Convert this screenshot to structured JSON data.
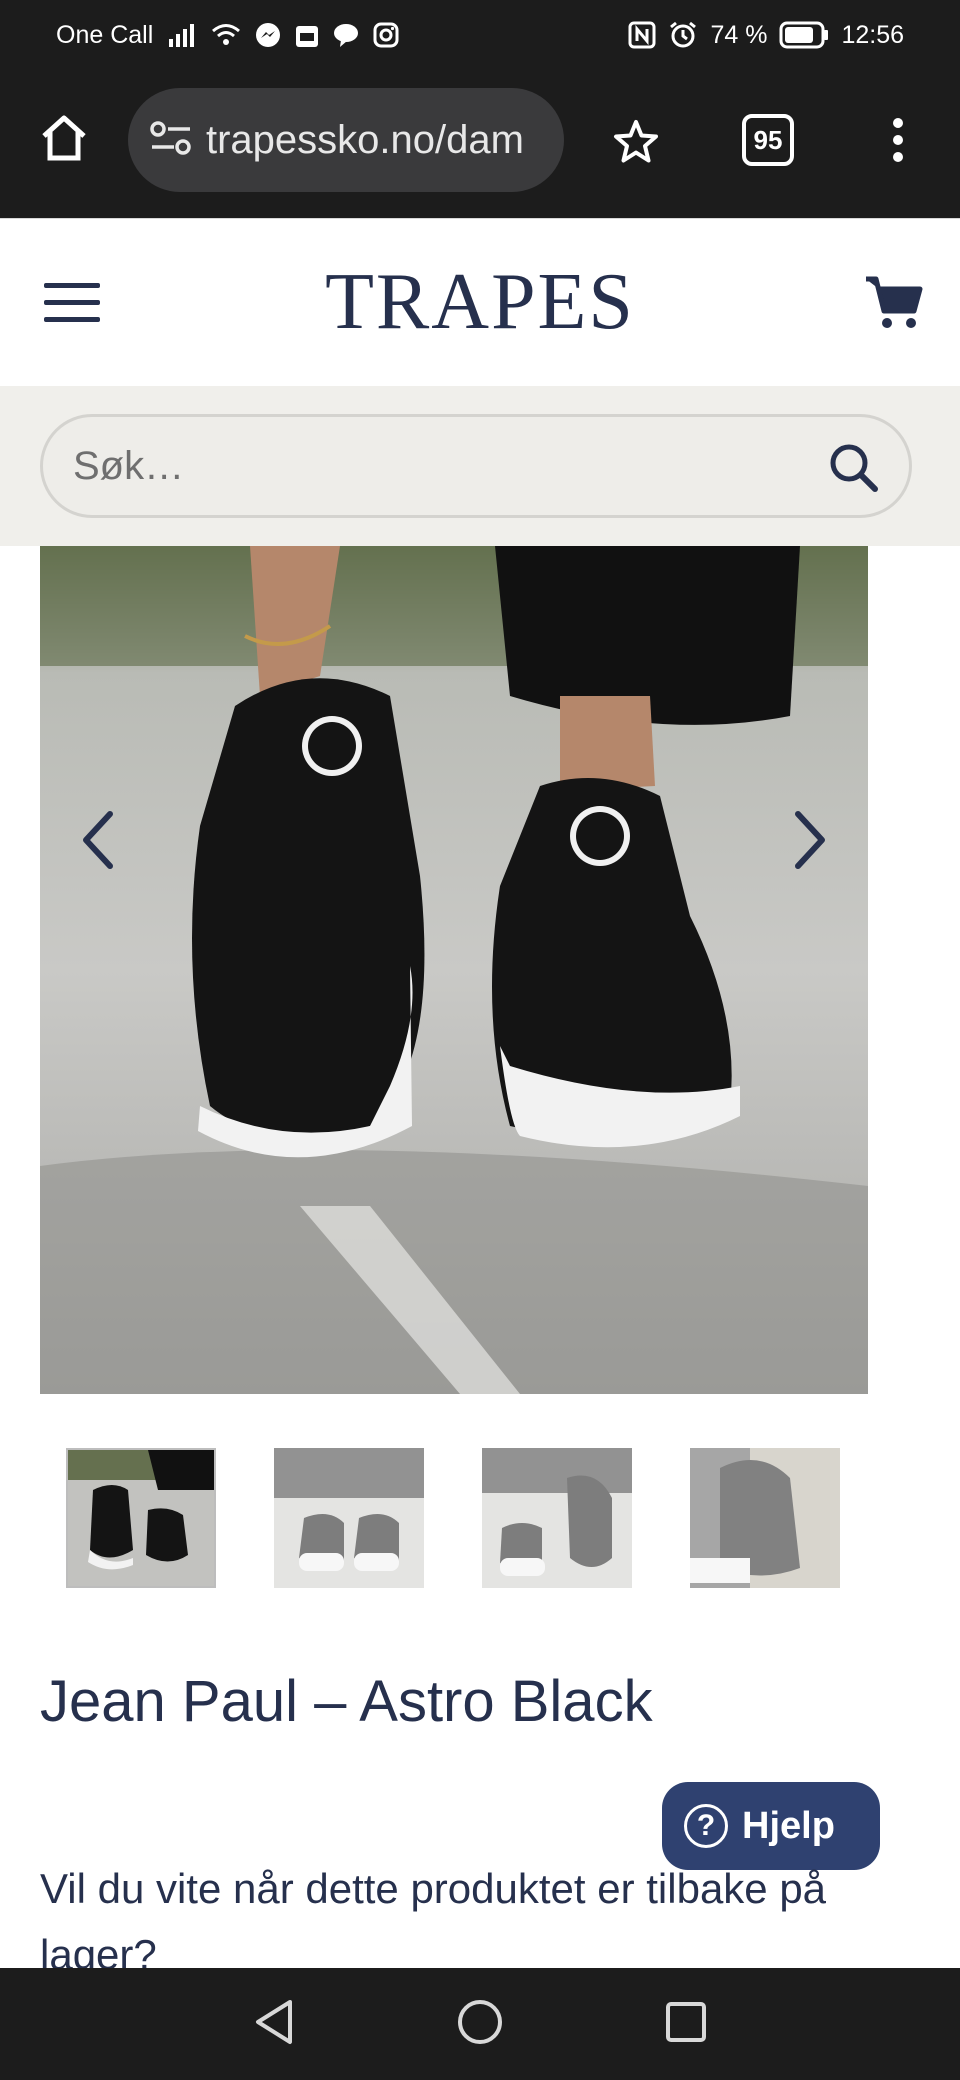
{
  "status_bar": {
    "carrier": "One Call",
    "battery": "74 %",
    "time": "12:56"
  },
  "browser": {
    "url": "trapessko.no/dam",
    "tab_count": "95"
  },
  "site": {
    "logo": "TRAPES"
  },
  "search": {
    "placeholder": "Søk…"
  },
  "product": {
    "title": "Jean Paul – Astro Black",
    "notify_text": "Vil du vite når dette produktet er tilbake på lager?"
  },
  "help": {
    "label": "Hjelp"
  },
  "colors": {
    "brand_navy": "#26304d",
    "help_bg": "#2f4170",
    "system_bar": "#1c1c1c"
  }
}
